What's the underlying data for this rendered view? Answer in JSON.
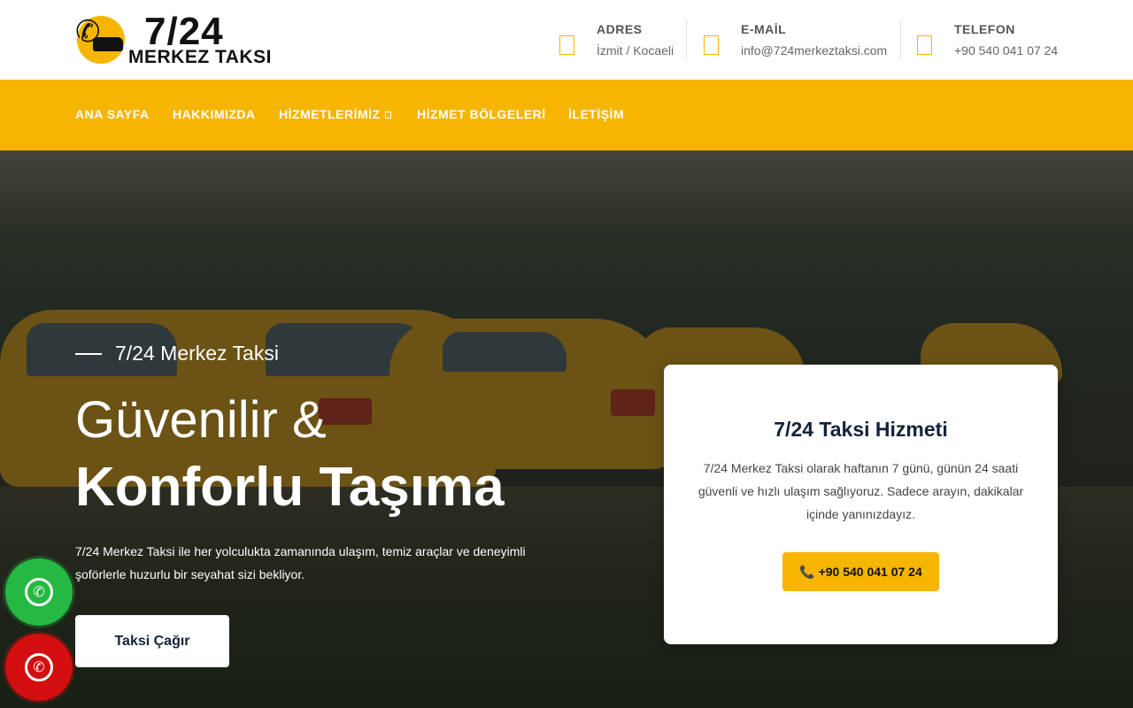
{
  "brand": {
    "logo_number": "7/24",
    "logo_text": "MERKEZ TAKSI"
  },
  "contact": [
    {
      "label": "ADRES",
      "value": "İzmit / Kocaeli",
      "icon": "map-pin-icon"
    },
    {
      "label": "E-MAİL",
      "value": "info@724merkeztaksi.com",
      "icon": "envelope-icon"
    },
    {
      "label": "TELEFON",
      "value": "+90 540 041 07 24",
      "icon": "phone-icon"
    }
  ],
  "nav": {
    "items": [
      {
        "label": "ANA SAYFA"
      },
      {
        "label": "HAKKIMIZDA"
      },
      {
        "label": "HİZMETLERİMİZ"
      },
      {
        "label": "HİZMET BÖLGELERİ"
      },
      {
        "label": "İLETİŞİM"
      }
    ]
  },
  "hero": {
    "eyebrow": "7/24 Merkez Taksi",
    "title_line1": "Güvenilir &",
    "title_line2": "Konforlu Taşıma",
    "description": "7/24 Merkez Taksi ile her yolculukta zamanında ulaşım, temiz araçlar ve deneyimli şoförlerle huzurlu bir seyahat sizi bekliyor.",
    "cta_label": "Taksi Çağır"
  },
  "card": {
    "title": "7/24 Taksi Hizmeti",
    "text": "7/24 Merkez Taksi olarak haftanın 7 günü, günün 24 saati güvenli ve hızlı ulaşım sağlıyoruz. Sadece arayın, dakikalar içinde yanınızdayız.",
    "button_icon": "📞",
    "button_label": "+90 540 041 07 24"
  },
  "floating": {
    "whatsapp_icon": "whatsapp-icon",
    "call_icon": "phone-icon"
  },
  "colors": {
    "accent": "#f6b500",
    "dark_navy": "#13223a",
    "whatsapp": "#25b843",
    "call": "#d30e0e"
  }
}
